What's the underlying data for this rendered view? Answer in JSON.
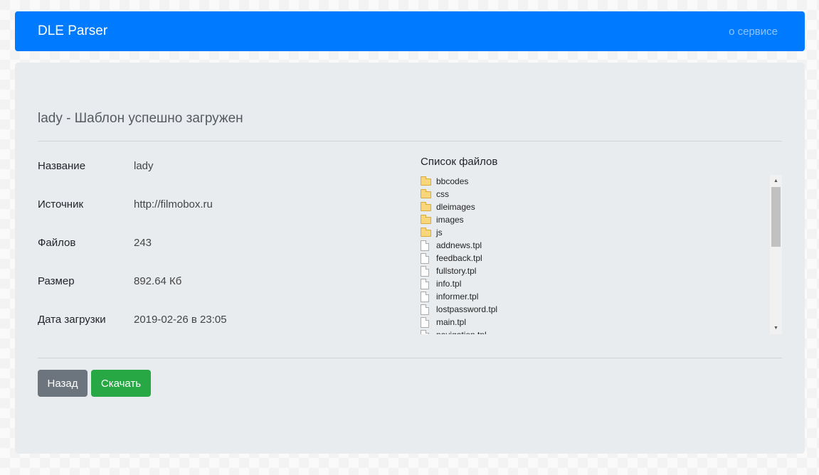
{
  "navbar": {
    "brand": "DLE Parser",
    "about_link": "о сервисе"
  },
  "page": {
    "title": "lady - Шаблон успешно загружен"
  },
  "info": [
    {
      "label": "Название",
      "value": "lady"
    },
    {
      "label": "Источник",
      "value": "http://filmobox.ru"
    },
    {
      "label": "Файлов",
      "value": "243"
    },
    {
      "label": "Размер",
      "value": "892.64 Кб"
    },
    {
      "label": "Дата загрузки",
      "value": "2019-02-26 в 23:05"
    }
  ],
  "files": {
    "title": "Список файлов",
    "items": [
      {
        "name": "bbcodes",
        "icon": "folder-icon"
      },
      {
        "name": "css",
        "icon": "folder-icon"
      },
      {
        "name": "dleimages",
        "icon": "folder-icon"
      },
      {
        "name": "images",
        "icon": "folder-icon"
      },
      {
        "name": "js",
        "icon": "folder-icon"
      },
      {
        "name": "addnews.tpl",
        "icon": "file-icon"
      },
      {
        "name": "feedback.tpl",
        "icon": "file-icon"
      },
      {
        "name": "fullstory.tpl",
        "icon": "file-icon"
      },
      {
        "name": "info.tpl",
        "icon": "file-icon"
      },
      {
        "name": "informer.tpl",
        "icon": "file-icon"
      },
      {
        "name": "lostpassword.tpl",
        "icon": "file-icon"
      },
      {
        "name": "main.tpl",
        "icon": "file-icon"
      },
      {
        "name": "navigation.tpl",
        "icon": "file-icon"
      }
    ]
  },
  "buttons": {
    "back": "Назад",
    "download": "Скачать"
  },
  "colors": {
    "navbar": "#007bff",
    "back_button": "#6c757d",
    "download_button": "#28a745"
  }
}
